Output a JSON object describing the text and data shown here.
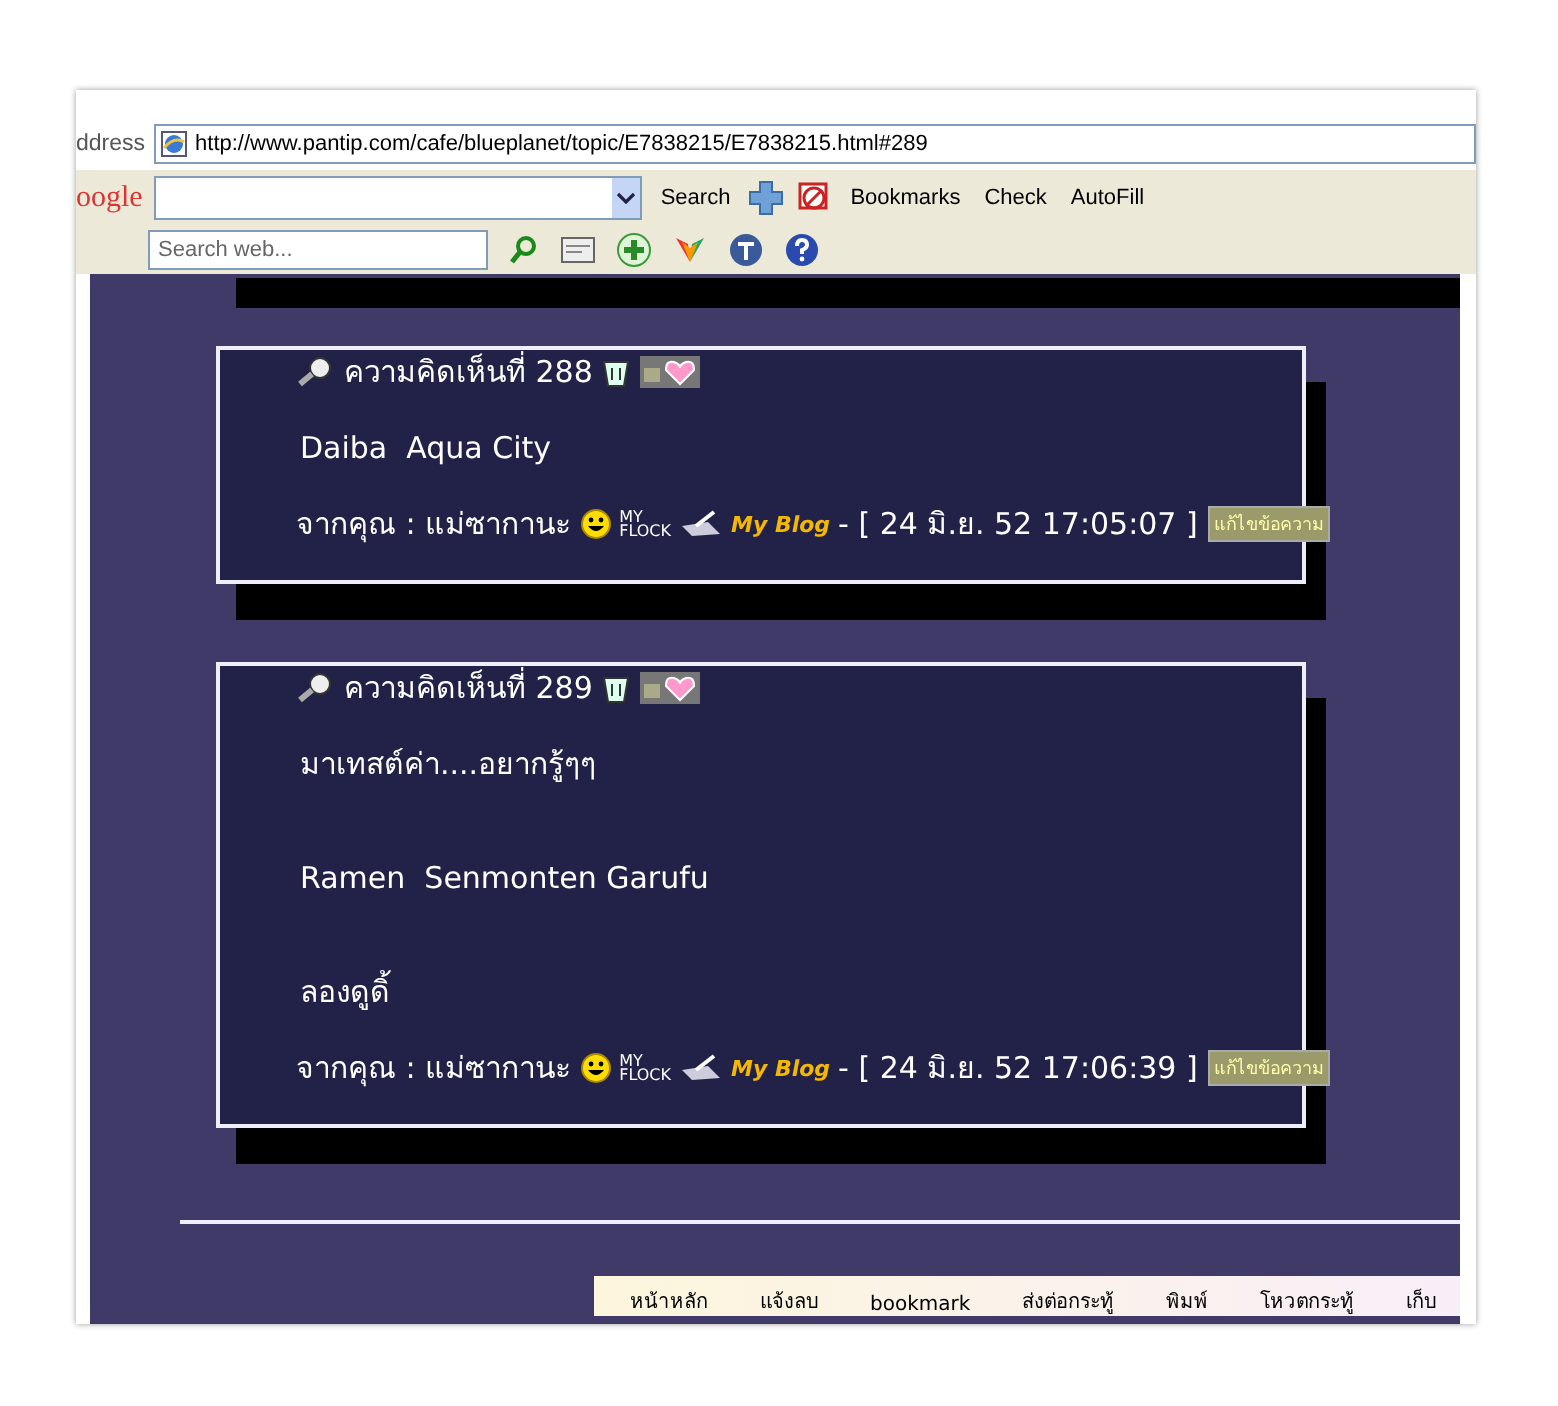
{
  "address_bar": {
    "label": "ddress",
    "url": "http://www.pantip.com/cafe/blueplanet/topic/E7838215/E7838215.html#289"
  },
  "google_toolbar": {
    "logo": "oogle",
    "search_button": "Search",
    "bookmarks_button": "Bookmarks",
    "check_button": "Check",
    "autofill_button": "AutoFill"
  },
  "search_toolbar": {
    "placeholder": "Search web..."
  },
  "posts": [
    {
      "title": "ความคิดเห็นที่ 288",
      "body": [
        "Daiba  Aqua City"
      ],
      "author": "จากคุณ : แม่ซากานะ",
      "flock": [
        "MY",
        "FLOCK"
      ],
      "blog": "My Blog",
      "timestamp": "- [ 24 มิ.ย. 52 17:05:07 ]",
      "edit_button": "แก้ไขข้อความ"
    },
    {
      "title": "ความคิดเห็นที่ 289",
      "body": [
        "มาเทสต์ค่า....อยากรู้ๆๆ",
        "Ramen  Senmonten Garufu",
        "ลองดูดิ้"
      ],
      "author": "จากคุณ : แม่ซากานะ",
      "flock": [
        "MY",
        "FLOCK"
      ],
      "blog": "My Blog",
      "timestamp": "- [ 24 มิ.ย. 52 17:06:39 ]",
      "edit_button": "แก้ไขข้อความ"
    }
  ],
  "bottom_menu": [
    "หน้าหลัก",
    "แจ้งลบ",
    "bookmark",
    "ส่งต่อกระทู้",
    "พิมพ์",
    "โหวตกระทู้",
    "เก็บ"
  ]
}
